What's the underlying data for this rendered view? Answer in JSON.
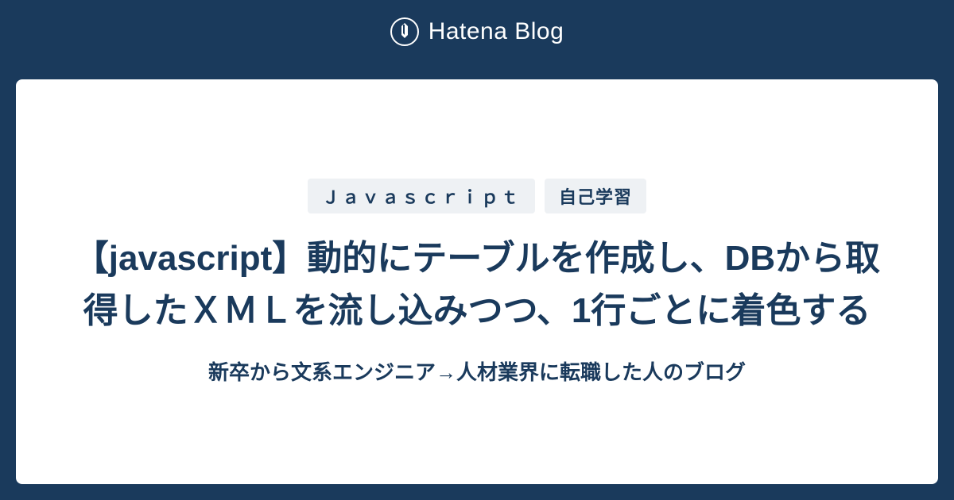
{
  "header": {
    "brand": "Hatena Blog"
  },
  "tags": [
    "Ｊａｖａｓｃｒｉｐｔ",
    "自己学習"
  ],
  "title": "【javascript】動的にテーブルを作成し、DBから取得したＸＭＬを流し込みつつ、1行ごとに着色する",
  "subtitle": "新卒から文系エンジニア→人材業界に転職した人のブログ",
  "colors": {
    "primary": "#1a3a5c",
    "tag_bg": "#eef1f4",
    "card_bg": "#ffffff"
  }
}
